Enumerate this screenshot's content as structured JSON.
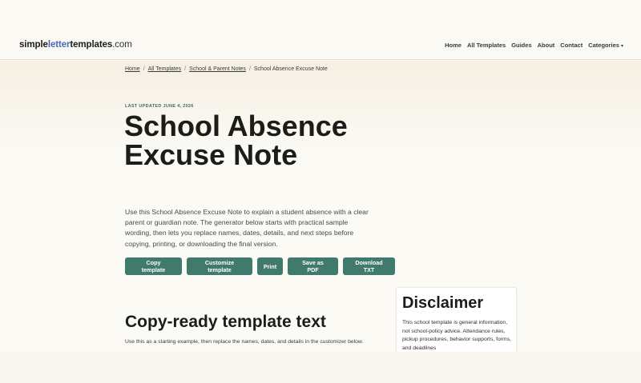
{
  "header": {
    "logo": {
      "part1": "simple",
      "part2": "letter",
      "part3": "templates",
      "tld": ".com"
    },
    "nav": [
      "Home",
      "All Templates",
      "Guides",
      "About",
      "Contact",
      "Categories"
    ],
    "nav_caret": "▾"
  },
  "breadcrumb": {
    "items": [
      "Home",
      "All Templates",
      "School & Parent Notes"
    ],
    "current": "School Absence Excuse Note",
    "separator": "/"
  },
  "hero": {
    "updated": "LAST UPDATED JUNE 4, 2026",
    "title": "School Absence Excuse Note",
    "intro": "Use this School Absence Excuse Note to explain a student absence with a clear parent or guardian note. The generator below starts with practical sample wording, then lets you replace names, dates, details, and next steps before copying, printing, or downloading the final version."
  },
  "actions": [
    "Copy template",
    "Customize template",
    "Print",
    "Save as PDF",
    "Download TXT"
  ],
  "section": {
    "title": "Copy-ready template text",
    "subtitle": "Use this as a starting example, then replace the names, dates, and details in the customizer below."
  },
  "disclaimer": {
    "title": "Disclaimer",
    "body": "This school template is general information, not school-policy advice. Attendance rules, pickup procedures, behavior supports, forms, and deadlines"
  },
  "colors": {
    "accent_button": "#3f7a6c",
    "logo_accent": "#4a6ab8",
    "updated_label": "#3d6f5f"
  }
}
